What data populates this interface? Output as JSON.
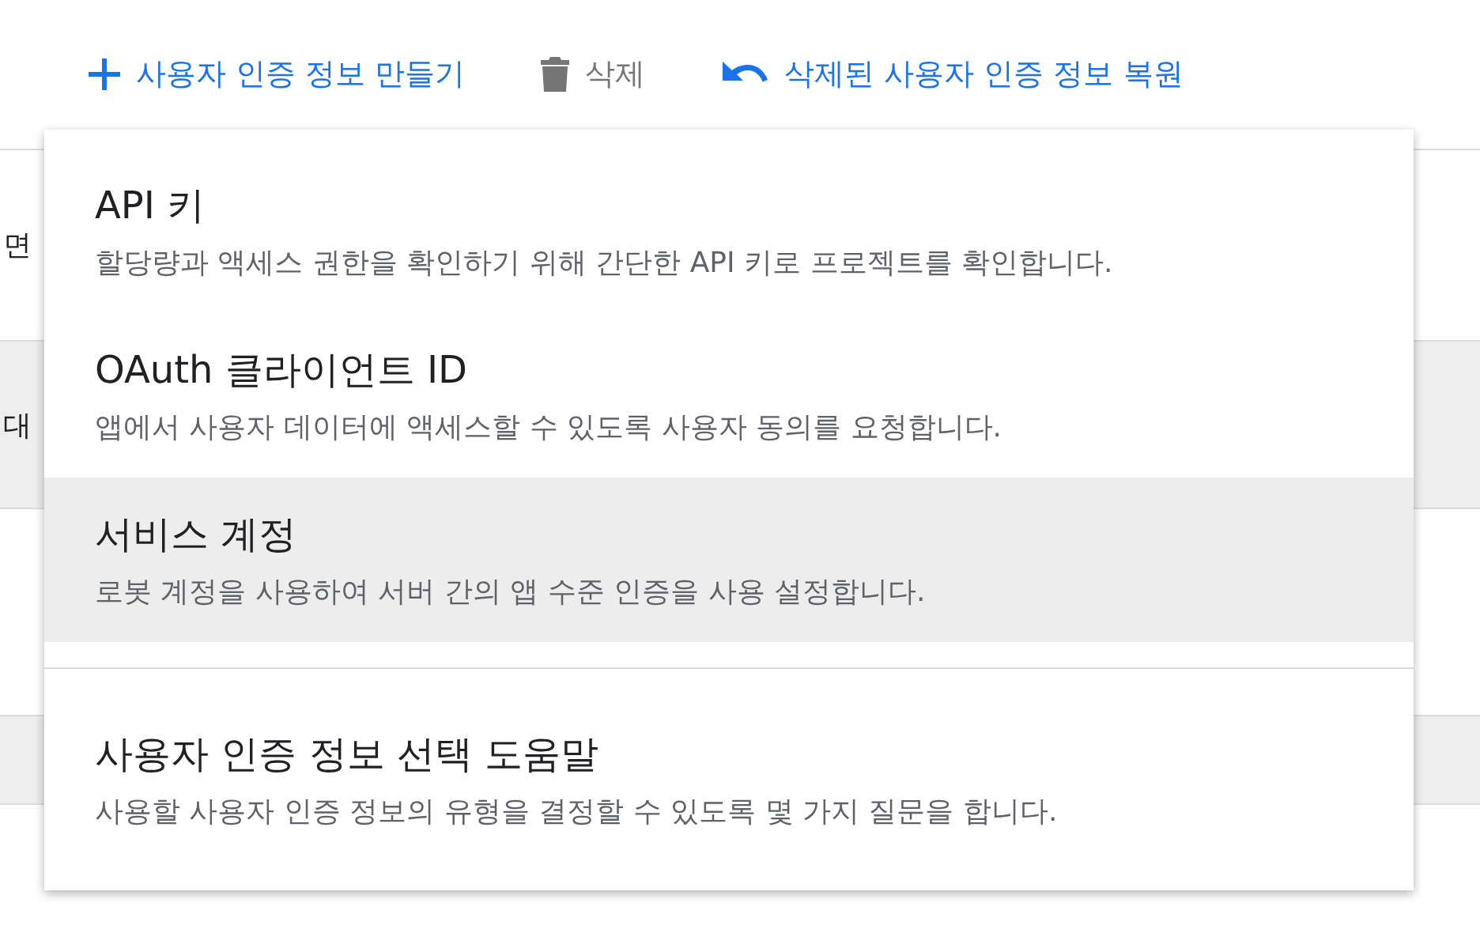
{
  "toolbar": [
    {
      "kind": "create",
      "label": "사용자 인증 정보 만들기",
      "disabled": false
    },
    {
      "kind": "delete",
      "label": "삭제",
      "disabled": true
    },
    {
      "kind": "restore",
      "label": "삭제된 사용자 인증 정보 복원",
      "disabled": false
    }
  ],
  "background_rows": [
    {
      "text": "면",
      "shaded": false
    },
    {
      "text": "대",
      "shaded": true
    },
    {
      "shaded": false
    },
    {
      "shaded": true
    }
  ],
  "menu": {
    "groups": [
      [
        {
          "title": "API 키",
          "description": "할당량과 액세스 권한을 확인하기 위해 간단한 API 키로 프로젝트를 확인합니다.",
          "selected": false
        },
        {
          "title": "OAuth 클라이언트 ID",
          "description": "앱에서 사용자 데이터에 액세스할 수 있도록 사용자 동의를 요청합니다.",
          "selected": false
        },
        {
          "title": "서비스 계정",
          "description": "로봇 계정을 사용하여 서버 간의 앱 수준 인증을 사용 설정합니다.",
          "selected": true
        }
      ],
      [
        {
          "title": "사용자 인증 정보 선택 도움말",
          "description": "사용할 사용자 인증 정보의 유형을 결정할 수 있도록 몇 가지 질문을 합니다.",
          "selected": false
        }
      ]
    ]
  }
}
